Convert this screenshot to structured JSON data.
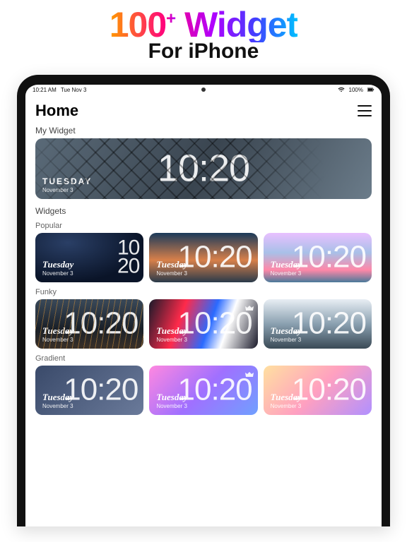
{
  "promo": {
    "title_num": "100",
    "title_plus": "+",
    "title_word": " Widget",
    "subtitle": "For iPhone"
  },
  "status": {
    "time": "10:21 AM",
    "date": "Tue Nov 3",
    "battery": "100%"
  },
  "header": {
    "title": "Home"
  },
  "clock": {
    "time": "10:20",
    "day": "Tuesday",
    "day_upper": "TUESDAY",
    "date": "November 3"
  },
  "sections": {
    "my_widget": "My Widget",
    "widgets": "Widgets",
    "popular": "Popular",
    "funky": "Funky",
    "gradient": "Gradient"
  }
}
